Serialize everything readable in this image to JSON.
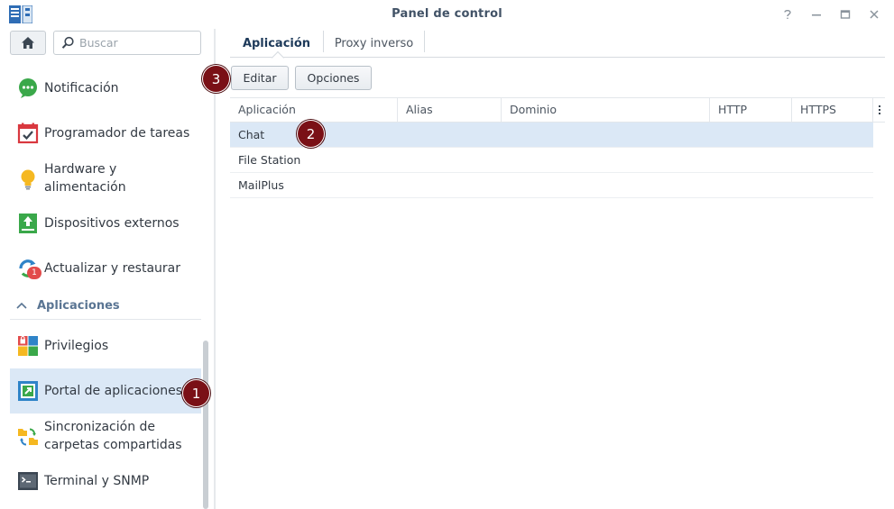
{
  "window": {
    "title": "Panel de control",
    "controls": {
      "help": "?",
      "minimize": "—",
      "maximize": "□",
      "close": "✕"
    }
  },
  "search": {
    "placeholder": "Buscar",
    "value": ""
  },
  "sidebar": {
    "items": [
      {
        "label": "Notificación",
        "icon": "notification-icon"
      },
      {
        "label": "Programador de tareas",
        "icon": "task-scheduler-icon"
      },
      {
        "label": "Hardware y alimentación",
        "icon": "hardware-power-icon"
      },
      {
        "label": "Dispositivos externos",
        "icon": "external-devices-icon"
      },
      {
        "label": "Actualizar y restaurar",
        "icon": "update-restore-icon",
        "badge": "1"
      }
    ],
    "section_title": "Aplicaciones",
    "app_items": [
      {
        "label": "Privilegios",
        "icon": "privileges-icon"
      },
      {
        "label": "Portal de aplicaciones",
        "icon": "application-portal-icon",
        "selected": true
      },
      {
        "label": "Sincronización de carpetas compartidas",
        "icon": "shared-folder-sync-icon"
      },
      {
        "label": "Terminal y SNMP",
        "icon": "terminal-icon"
      }
    ]
  },
  "tabs": [
    {
      "label": "Aplicación",
      "active": true
    },
    {
      "label": "Proxy inverso",
      "active": false
    }
  ],
  "toolbar": {
    "edit_label": "Editar",
    "options_label": "Opciones"
  },
  "table": {
    "columns": [
      "Aplicación",
      "Alias",
      "Dominio",
      "HTTP",
      "HTTPS"
    ],
    "rows": [
      {
        "app": "Chat",
        "selected": true
      },
      {
        "app": "File Station",
        "selected": false
      },
      {
        "app": "MailPlus",
        "selected": false
      }
    ]
  },
  "markers": [
    "1",
    "2",
    "3"
  ],
  "colors": {
    "selection": "#dbe8f6",
    "marker": "#7a1016",
    "accent_title": "#415266"
  }
}
